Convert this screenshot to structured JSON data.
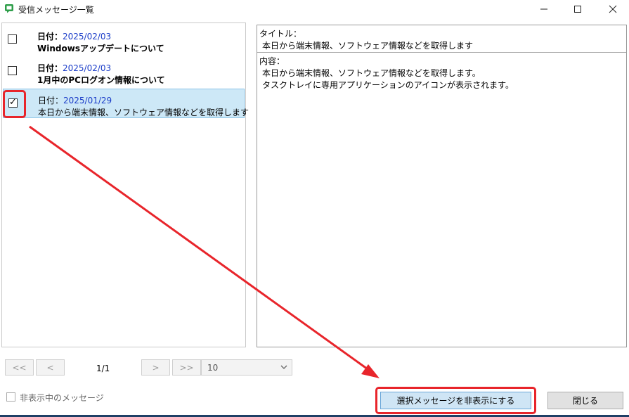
{
  "window": {
    "title": "受信メッセージ一覧",
    "icon": "message-app-icon",
    "controls": [
      "minimize-icon",
      "maximize-icon",
      "close-icon"
    ]
  },
  "messages": [
    {
      "date_label": "日付：",
      "date": "2025/02/03",
      "title": "Windowsアップデートについて",
      "checked": false,
      "selected": false
    },
    {
      "date_label": "日付：",
      "date": "2025/02/03",
      "title": "1月中のPCログオン情報について",
      "checked": false,
      "selected": false
    },
    {
      "date_label": "日付：",
      "date": "2025/01/29",
      "title": "本日から端末情報、ソフトウェア情報などを取得します",
      "checked": true,
      "selected": true
    }
  ],
  "detail": {
    "title_label": "タイトル：",
    "title_value": "本日から端末情報、ソフトウェア情報などを取得します",
    "content_label": "内容：",
    "content_lines": [
      "本日から端末情報、ソフトウェア情報などを取得します。",
      "タスクトレイに専用アプリケーションのアイコンが表示されます。"
    ]
  },
  "pagination": {
    "first": "<<",
    "prev": "<",
    "page_info": "1/1",
    "next": ">",
    "last": ">>",
    "page_size": "10"
  },
  "footer": {
    "show_hidden_label": "非表示中のメッセージ",
    "hide_selected_button": "選択メッセージを非表示にする",
    "close_button": "閉じる"
  },
  "colors": {
    "accent_red": "#e8252b",
    "date_blue": "#1a3cc8",
    "selected_row": "#cde8f7"
  }
}
